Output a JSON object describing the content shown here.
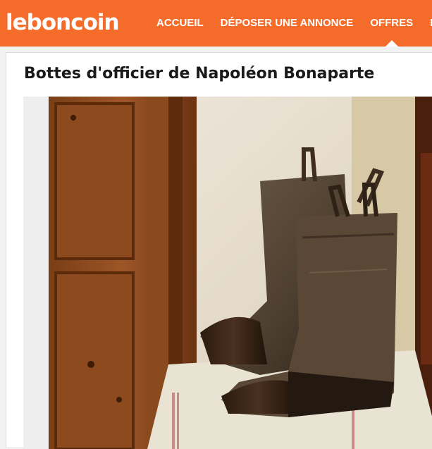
{
  "header": {
    "logo_text": "leboncoin",
    "brand_color": "#f56b2a",
    "nav": [
      {
        "label": "ACCUEIL"
      },
      {
        "label": "DÉPOSER UNE ANNONCE"
      },
      {
        "label": "OFFRES"
      },
      {
        "label": "DE"
      }
    ],
    "active_nav": "OFFRES"
  },
  "listing": {
    "title": "Bottes d'officier de Napoléon Bonaparte"
  }
}
